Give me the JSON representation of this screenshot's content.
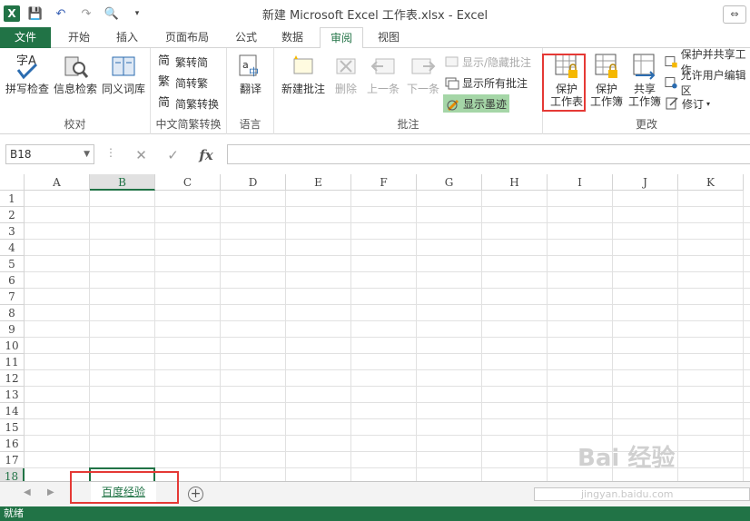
{
  "window": {
    "title": "新建 Microsoft Excel 工作表.xlsx - Excel",
    "restore_label": "⇔"
  },
  "qat": {
    "excel_icon": "X",
    "save": "💾",
    "undo": "↶",
    "redo": "↷",
    "preview": "🔍",
    "more": "▾"
  },
  "tabs": [
    {
      "label": "文件"
    },
    {
      "label": "开始"
    },
    {
      "label": "插入"
    },
    {
      "label": "页面布局"
    },
    {
      "label": "公式"
    },
    {
      "label": "数据"
    },
    {
      "label": "审阅"
    },
    {
      "label": "视图"
    }
  ],
  "ribbon": {
    "proofing": {
      "label": "校对",
      "spell": "拼写检查",
      "research": "信息检索",
      "thesaurus": "同义词库"
    },
    "chinese": {
      "label": "中文简繁转换",
      "to_trad": "繁转简",
      "to_simp": "简转繁",
      "convert": "简繁转换"
    },
    "language": {
      "label": "语言",
      "translate": "翻译"
    },
    "comments": {
      "label": "批注",
      "new": "新建批注",
      "delete": "删除",
      "prev": "上一条",
      "next": "下一条",
      "show_hide": "显示/隐藏批注",
      "show_all": "显示所有批注",
      "show_ink": "显示墨迹"
    },
    "changes": {
      "label": "更改",
      "protect_sheet_1": "保护",
      "protect_sheet_2": "工作表",
      "protect_book_1": "保护",
      "protect_book_2": "工作簿",
      "share_book_1": "共享",
      "share_book_2": "工作簿",
      "protect_share": "保护并共享工作",
      "allow_edit": "允许用户编辑区",
      "track": "修订"
    }
  },
  "formula_bar": {
    "name_box": "B18",
    "cancel": "✕",
    "enter": "✓",
    "fx": "fx",
    "dots": "⋮"
  },
  "columns": [
    "A",
    "B",
    "C",
    "D",
    "E",
    "F",
    "G",
    "H",
    "I",
    "J",
    "K"
  ],
  "rows": [
    "1",
    "2",
    "3",
    "4",
    "5",
    "6",
    "7",
    "8",
    "9",
    "10",
    "11",
    "12",
    "13",
    "14",
    "15",
    "16",
    "17",
    "18"
  ],
  "sheets": {
    "active": "百度经验",
    "prev": "◀",
    "next": "▶",
    "add": "+"
  },
  "status": {
    "ready": "就绪"
  },
  "watermark": {
    "main": "Bai 经验",
    "sub": "jingyan.baidu.com"
  },
  "colors": {
    "accent": "#217346",
    "highlight": "#e53935"
  }
}
